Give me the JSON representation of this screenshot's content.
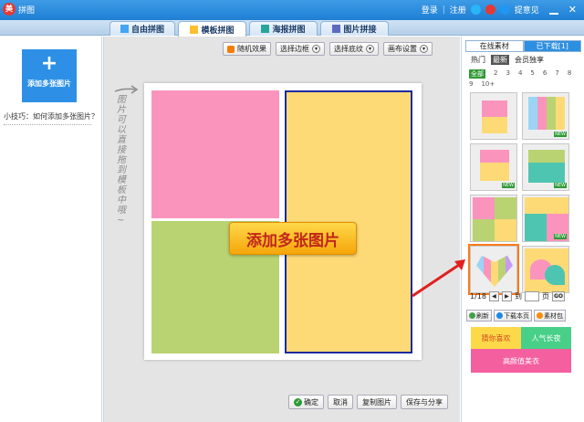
{
  "window": {
    "title": "拼图",
    "login": "登录",
    "register": "注册",
    "feedback": "提意见",
    "separator": "|"
  },
  "tabs": [
    {
      "label": "自由拼图",
      "icon": "freeform-icon"
    },
    {
      "label": "模板拼图",
      "icon": "template-icon"
    },
    {
      "label": "海报拼图",
      "icon": "poster-icon"
    },
    {
      "label": "图片拼接",
      "icon": "splice-icon"
    }
  ],
  "left": {
    "add_plus": "+",
    "add_label": "添加多张图片",
    "tip": "小技巧：如何添加多张图片？"
  },
  "toolbar": {
    "random": "随机效果",
    "border": "选择边框",
    "texture": "选择底纹",
    "canvas": "画布设置",
    "caret": "▾"
  },
  "canvas": {
    "hint_text": "图片可以直接拖到模板中哦~",
    "add_multi": "添加多张图片",
    "colors": {
      "pink": "#fb94bd",
      "green": "#b9d373",
      "yellow": "#fdda76",
      "selection": "#1c2aa0"
    }
  },
  "bottom": {
    "confirm": "确定",
    "confirm_icon": "✓",
    "cancel": "取消",
    "copy": "复制图片",
    "save_share": "保存与分享"
  },
  "right": {
    "tab_online": "在线素材",
    "tab_downloaded": "已下载[1]",
    "filters": [
      "热门",
      "最新",
      "会员独享"
    ],
    "numbers": [
      "全部",
      "2",
      "3",
      "4",
      "5",
      "6",
      "7",
      "8",
      "9",
      "10+"
    ],
    "new_badge": "NEW",
    "pager": {
      "page": "1/18",
      "prev": "◀",
      "next": "▶",
      "goto": "到",
      "unit": "页",
      "go": "GO"
    },
    "actions": [
      "刷新",
      "下载本页",
      "素材包"
    ],
    "promo": [
      "猜你喜欢",
      "人气长夜",
      "高颜值美衣"
    ]
  }
}
